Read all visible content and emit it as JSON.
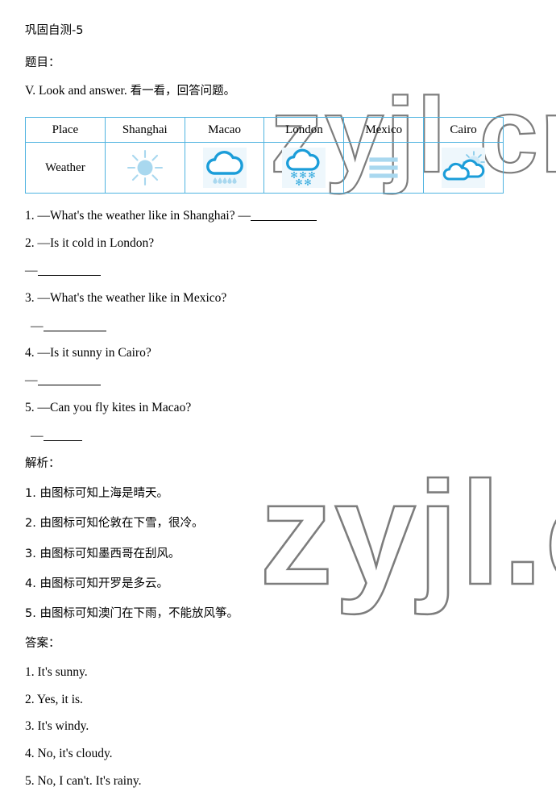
{
  "document": {
    "heading": "巩固自测-5",
    "prompt_label": "题目：",
    "instruction": "V. Look and answer. 看一看，回答问题。"
  },
  "table": {
    "columns": [
      "Place",
      "Shanghai",
      "Macao",
      "London",
      "Mexico",
      "Cairo"
    ],
    "row_label": "Weather",
    "icons": [
      {
        "city": "Shanghai",
        "icon": "sun-icon",
        "weather": "sunny"
      },
      {
        "city": "Macao",
        "icon": "rain-cloud-icon",
        "weather": "rainy"
      },
      {
        "city": "London",
        "icon": "snow-cloud-icon",
        "weather": "snowy"
      },
      {
        "city": "Mexico",
        "icon": "wind-icon",
        "weather": "windy"
      },
      {
        "city": "Cairo",
        "icon": "cloudy-sun-icon",
        "weather": "cloudy"
      }
    ]
  },
  "questions": [
    {
      "num": "1.",
      "text": "—What's the weather like in Shanghai? —",
      "inline_blank": true
    },
    {
      "num": "2.",
      "text": "—Is it cold in London?"
    },
    {
      "num": "3.",
      "text": "—What's the weather like in Mexico?"
    },
    {
      "num": "4.",
      "text": "—Is it sunny in Cairo?"
    },
    {
      "num": "5.",
      "text": "—Can you fly kites in Macao?"
    }
  ],
  "answer_dash": "—",
  "analysis": {
    "title": "解析：",
    "items": [
      "1. 由图标可知上海是晴天。",
      "2. 由图标可知伦敦在下雪，很冷。",
      "3. 由图标可知墨西哥在刮风。",
      "4. 由图标可知开罗是多云。",
      "5. 由图标可知澳门在下雨，不能放风筝。"
    ]
  },
  "answers": {
    "title": "答案：",
    "items": [
      "1. It's sunny.",
      "2. Yes, it is.",
      "3. It's windy.",
      "4. No, it's cloudy.",
      "5. No, I can't. It's rainy."
    ]
  },
  "watermark": {
    "top_text": "zyjl.cn",
    "bottom_text": "zyjl.c",
    "color": "#7d7d7d"
  },
  "colors": {
    "icon_blue": "#1b9dd9",
    "icon_light_blue": "#a9d8ef",
    "table_border": "#4fb3e0",
    "icon_bg": "#eef7fc"
  }
}
